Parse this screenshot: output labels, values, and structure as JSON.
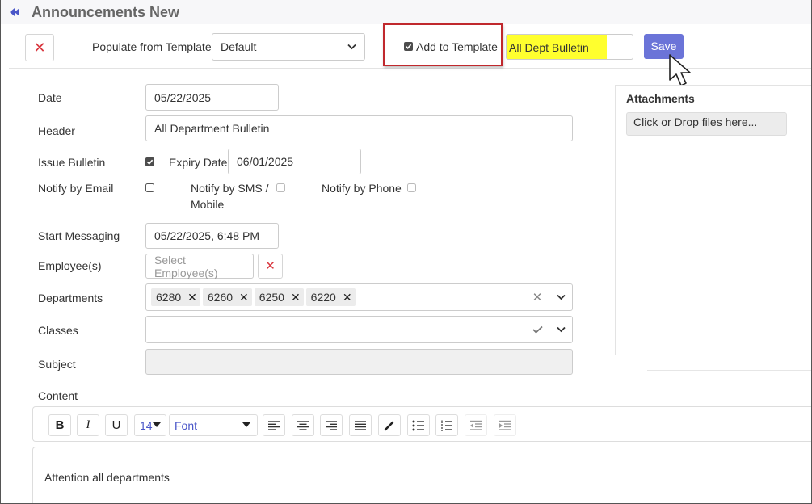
{
  "title": "Announcements New",
  "toolbar": {
    "close_label": "✕",
    "populate_label": "Populate from Template",
    "template_value": "Default",
    "add_to_template_label": "Add to Template",
    "add_to_template_checked": true,
    "template_name_value": "All Dept Bulletin",
    "save_label": "Save"
  },
  "form": {
    "date_label": "Date",
    "date_value": "05/22/2025",
    "header_label": "Header",
    "header_value": "All Department Bulletin",
    "issue_bulletin_label": "Issue Bulletin",
    "issue_bulletin_checked": true,
    "expiry_label": "Expiry Date",
    "expiry_value": "06/01/2025",
    "notify_email_label": "Notify by Email",
    "notify_sms_label_1": "Notify by SMS /",
    "notify_sms_label_2": "Mobile",
    "notify_phone_label": "Notify by Phone",
    "start_messaging_label": "Start Messaging",
    "start_messaging_value": "05/22/2025, 6:48 PM",
    "employees_label": "Employee(s)",
    "employees_placeholder": "Select Employee(s)",
    "departments_label": "Departments",
    "departments": [
      "6280",
      "6260",
      "6250",
      "6220"
    ],
    "classes_label": "Classes",
    "subject_label": "Subject",
    "content_label": "Content"
  },
  "attachments": {
    "title": "Attachments",
    "drop_text": "Click or Drop files here..."
  },
  "editor": {
    "bold": "B",
    "italic": "I",
    "underline": "U",
    "font_size": "14",
    "font": "Font",
    "body_text": "Attention all departments"
  },
  "colors": {
    "accent": "#6b74d8",
    "danger": "#d9363e",
    "highlight": "#ffff2e",
    "callout_border": "#c0282d"
  }
}
